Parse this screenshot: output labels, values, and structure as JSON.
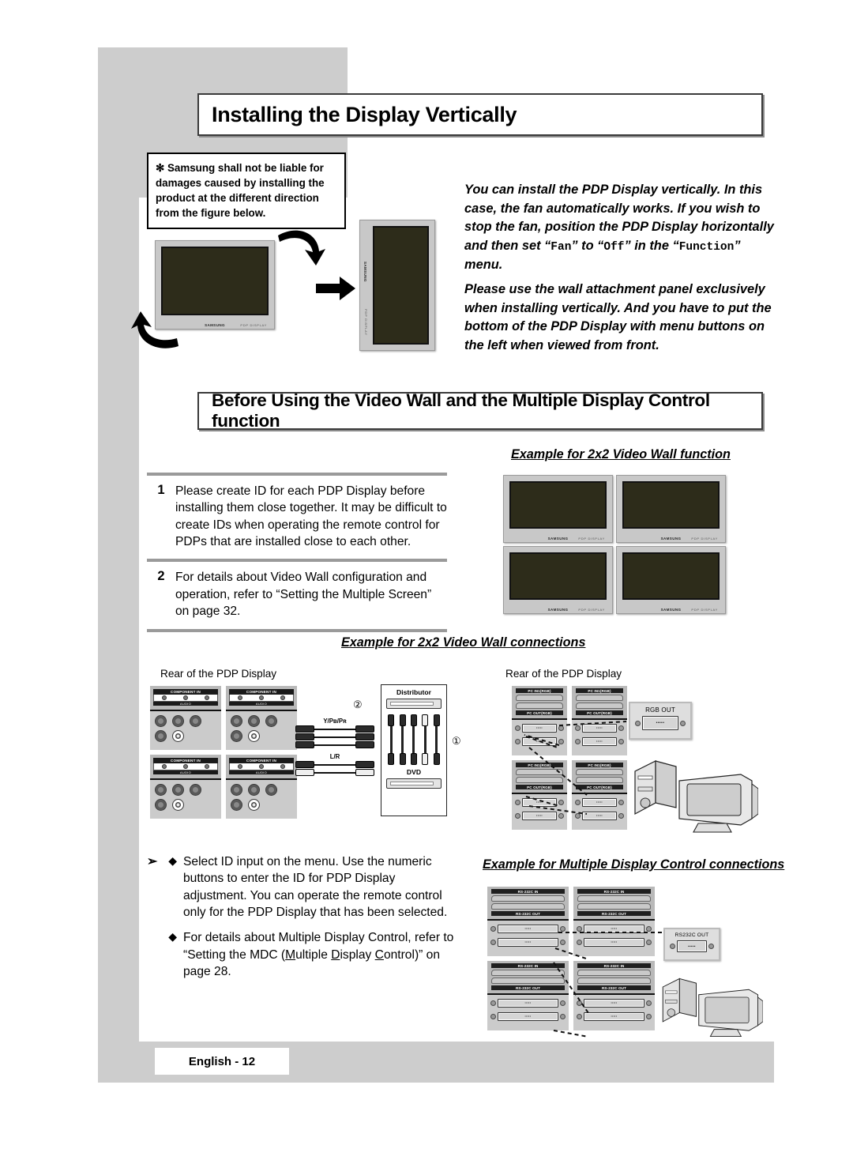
{
  "page": {
    "footer_label": "English - 12",
    "colors": {
      "gray_panel": "#cdcdcd",
      "screen": "#2d2c1a",
      "bezel": "#c8c8c8"
    }
  },
  "section1": {
    "title": "Installing the Display Vertically",
    "note": "✻ Samsung shall not be liable for damages caused by installing the product at the different direction from the figure below.",
    "paragraph1_a": "You can install the PDP Display vertically. In this case, the fan automatically works. If you wish to stop the fan, position the PDP Display horizontally and then set “",
    "paragraph1_fan": "Fan",
    "paragraph1_b": "” to “",
    "paragraph1_off": "Off",
    "paragraph1_c": "” in the “",
    "paragraph1_function": "Function",
    "paragraph1_d": "” menu.",
    "paragraph2": "Please use the wall attachment panel exclusively when installing vertically. And you have to put the bottom of the PDP Display with menu buttons on the left when viewed from front.",
    "display_logo": "SAMSUNG",
    "display_model": "PDP DISPLAY"
  },
  "section2": {
    "title": "Before Using the Video Wall and the Multiple Display Control function",
    "steps": [
      {
        "number": "1",
        "text": "Please create ID for each PDP Display before installing them close together. It may be difficult to create IDs when operating the remote control for PDPs that are installed close to each other."
      },
      {
        "number": "2",
        "text": "For details about Video Wall configuration and operation, refer to “Setting the Multiple Screen” on page 32."
      }
    ],
    "bullets": [
      {
        "marker": "➢",
        "diamond": "◆",
        "text": "Select ID input on the menu. Use the numeric buttons to enter the ID for PDP Display adjustment. You can operate the remote control only for the PDP Display that has been selected."
      },
      {
        "marker": "",
        "diamond": "◆",
        "text_a": "For details about Multiple Display Control, refer to “Setting the MDC (",
        "u1": "M",
        "text_b": "ultiple ",
        "u2": "D",
        "text_c": "isplay ",
        "u3": "C",
        "text_d": "ontrol)” on page 28."
      }
    ]
  },
  "captions": {
    "video_wall_function": "Example for 2x2 Video Wall function",
    "video_wall_connections": "Example for 2x2 Video Wall connections",
    "mdc_connections": "Example for Multiple Display Control connections"
  },
  "diagram_left": {
    "rear_label": "Rear of the PDP Display",
    "panel_title": "COMPONENT IN",
    "panel_audio": "AUDIO",
    "cable_labels": {
      "component": "Y/Pʙ/Pʀ",
      "audio": "L/R"
    },
    "distributor_label": "Distributor",
    "dvd_label": "DVD",
    "callout_number_1": "①",
    "callout_number_2": "②"
  },
  "diagram_right": {
    "rear_label": "Rear of the PDP Display",
    "panel_in": "PC IN1(RGB)",
    "panel_out": "PC OUT(RGB)",
    "callout": "RGB OUT",
    "pins": "•••••"
  },
  "diagram_mdc": {
    "panel_in": "RS-232C IN",
    "panel_out": "RS-232C OUT",
    "callout": "RS232C OUT"
  }
}
